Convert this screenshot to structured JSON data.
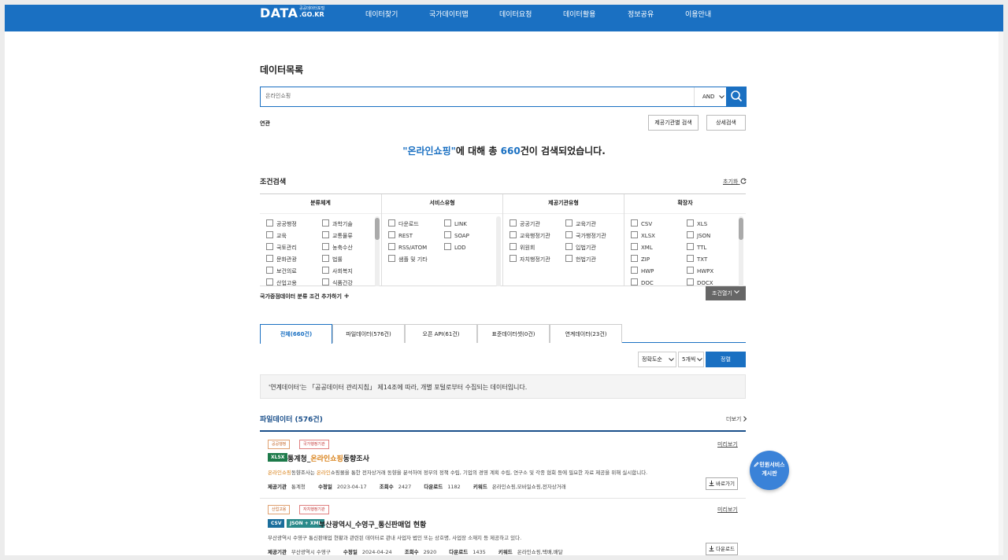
{
  "header": {
    "logo_main": "DATA",
    "logo_sub": "공공데이터포털",
    "logo_domain": ".GO.KR",
    "nav": [
      "데이터찾기",
      "국가데이터맵",
      "데이터요청",
      "데이터활용",
      "정보공유",
      "이용안내"
    ]
  },
  "page_title": "데이터목록",
  "search": {
    "value": "온라인쇼핑",
    "operator": "AND"
  },
  "related_label": "연관",
  "buttons": {
    "provider_search": "제공기관별 검색",
    "detail_search": "상세검색"
  },
  "summary": {
    "query": "\"온라인쇼핑\"",
    "text1": "에 대해 총 ",
    "count": "660",
    "text2": "건이 검색되었습니다."
  },
  "conditions": {
    "title": "조건검색",
    "reset": "초기화",
    "columns": [
      {
        "title": "분류체계",
        "items": [
          "공공행정",
          "과학기술",
          "교육",
          "교통물류",
          "국토관리",
          "농축수산",
          "문화관광",
          "법률",
          "보건의료",
          "사회복지",
          "산업고용",
          "식품건강"
        ]
      },
      {
        "title": "서비스유형",
        "items": [
          "다운로드",
          "LINK",
          "REST",
          "SOAP",
          "RSS/ATOM",
          "LOD",
          "샘플 및 기타"
        ]
      },
      {
        "title": "제공기관유형",
        "items": [
          "공공기관",
          "교육기관",
          "교육행정기관",
          "국가행정기관",
          "위원회",
          "입법기관",
          "자치행정기관",
          "헌법기관"
        ]
      },
      {
        "title": "확장자",
        "items": [
          "CSV",
          "XLS",
          "XLSX",
          "JSON",
          "XML",
          "TTL",
          "ZIP",
          "TXT",
          "HWP",
          "HWPX",
          "DOC",
          "DOCX"
        ]
      }
    ],
    "add_condition": "국가중점데이터 분류 조건 추가하기",
    "open_condition": "조건열기"
  },
  "tabs": [
    "전체(660건)",
    "파일데이터(576건)",
    "오픈 API(61건)",
    "표준데이터셋(0건)",
    "연계데이터(23건)"
  ],
  "sort": {
    "order": "정확도순",
    "count": "5개씩",
    "button": "정렬"
  },
  "notice": "'연계데이터'는 「공공데이터 관리지침」 제14조에 따라, 개별 포털로부터 수집되는 데이터입니다.",
  "section": {
    "title": "파일데이터 (576건)",
    "more": "더보기"
  },
  "results": [
    {
      "tags": [
        "공공행정",
        "국가행정기관"
      ],
      "formats": [
        "XLSX"
      ],
      "title_pre": "통계청_",
      "title_hl": "온라인쇼핑",
      "title_post": "동향조사",
      "desc_hl1": "온라인쇼핑",
      "desc_mid1": "동향조사는 ",
      "desc_hl2": "온라인",
      "desc_rest": "쇼핑몰을 통한 전자상거래 동향을 분석하여 정부의 정책 수립, 기업의 경영 계획 수립, 연구소 및 각종 협회 등에 필요한 자료 제공을 위해 실시합니다.",
      "meta": {
        "provider": "통계청",
        "modified": "2023-04-17",
        "views": "2427",
        "downloads": "1182",
        "keywords": "온라인쇼핑,모바일쇼핑,전자상거래"
      },
      "preview": "미리보기",
      "action": "바로가기"
    },
    {
      "tags": [
        "산업고용",
        "자치행정기관"
      ],
      "formats": [
        "CSV",
        "JSON + XML"
      ],
      "title_pre": "부산광역시_수영구_통신판매업 현황",
      "title_hl": "",
      "title_post": "",
      "desc": "부산광역시 수영구 통신판매업 현황과 관련된 데이터로 관내 사업자 법인 또는 상호명, 사업장 소재지 등 제공하고 있다.",
      "meta": {
        "provider": "부산광역시 수영구",
        "modified": "2024-04-24",
        "views": "2920",
        "downloads": "1435",
        "keywords": "온라인쇼핑,택배,배달"
      },
      "preview": "미리보기",
      "action": "다운로드"
    }
  ],
  "meta_labels": {
    "provider": "제공기관",
    "modified": "수정일",
    "views": "조회수",
    "downloads": "다운로드",
    "keywords": "키워드"
  },
  "float_button": [
    "민원서비스",
    "게시판"
  ],
  "colors": {
    "primary": "#1a70c2",
    "highlight": "#d9821a",
    "xlsx": "#1d7a4a",
    "csv": "#1b6e9c",
    "json": "#2b8a8a"
  }
}
